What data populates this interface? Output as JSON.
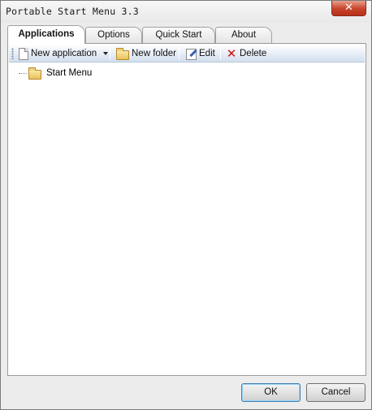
{
  "window": {
    "title": "Portable Start Menu 3.3",
    "close_glyph": "✕"
  },
  "tabs": [
    {
      "label": "Applications",
      "active": true
    },
    {
      "label": "Options",
      "active": false
    },
    {
      "label": "Quick Start",
      "active": false
    },
    {
      "label": "About",
      "active": false
    }
  ],
  "toolbar": {
    "new_application": "New application",
    "new_folder": "New folder",
    "edit": "Edit",
    "delete": "Delete",
    "delete_glyph": "✕"
  },
  "tree": {
    "root_label": "Start Menu"
  },
  "buttons": {
    "ok": "OK",
    "cancel": "Cancel"
  },
  "colors": {
    "close_button": "#c7432a",
    "delete_icon": "#d01010",
    "toolbar_gradient_end": "#d3dfee"
  }
}
